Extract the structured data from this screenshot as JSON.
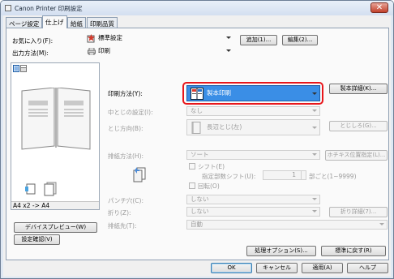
{
  "window": {
    "title": "Canon Printer 印刷設定",
    "close_symbol": "✕"
  },
  "tabs": [
    {
      "label": "ページ設定",
      "active": false
    },
    {
      "label": "仕上げ",
      "active": true
    },
    {
      "label": "給紙",
      "active": false
    },
    {
      "label": "印刷品質",
      "active": false
    }
  ],
  "favorites": {
    "label": "お気に入り(F):",
    "value": "標準設定",
    "add_button": "追加(1)...",
    "edit_button": "編集(2)..."
  },
  "output_method": {
    "label": "出力方法(M):",
    "value": "印刷"
  },
  "preview": {
    "caption": "A4 x2 -> A4",
    "device_preview_button": "デバイスプレビュー(W)",
    "settings_check_button": "設定確認(V)"
  },
  "print_method": {
    "label": "印刷方法(Y):",
    "value": "製本印刷",
    "detail_button": "製本詳細(K)...",
    "highlight_color": "#e8161b",
    "selected_bg": "#3a8ee6"
  },
  "center_removal": {
    "label": "中とじの設定(I):",
    "value": "なし"
  },
  "binding_direction": {
    "label": "とじ方向(B):",
    "value": "長辺とじ(左)",
    "margin_button": "とじしろ(G)..."
  },
  "finishing": {
    "label": "排紙方法(H):",
    "value": "ソート",
    "staple_button": "ホチキス位置指定(L)..."
  },
  "shift": {
    "label": "シフト(E)",
    "sub_label": "指定部数シフト(U):",
    "count": "1",
    "unit": "部ごと(1~9999)"
  },
  "rotate": {
    "label": "回転(O)"
  },
  "punch": {
    "label": "パンチ穴(C):",
    "value": "しない"
  },
  "fold": {
    "label": "折り(Z):",
    "value": "しない",
    "detail_button": "折り詳細(7)..."
  },
  "output_dest": {
    "label": "排紙先(T):",
    "value": "自動"
  },
  "bottom_buttons": {
    "options": "処理オプション(S)...",
    "restore": "標準に戻す(R)"
  },
  "dialog_buttons": {
    "ok": "OK",
    "cancel": "キャンセル",
    "apply": "適用(A)",
    "help": "ヘルプ"
  }
}
